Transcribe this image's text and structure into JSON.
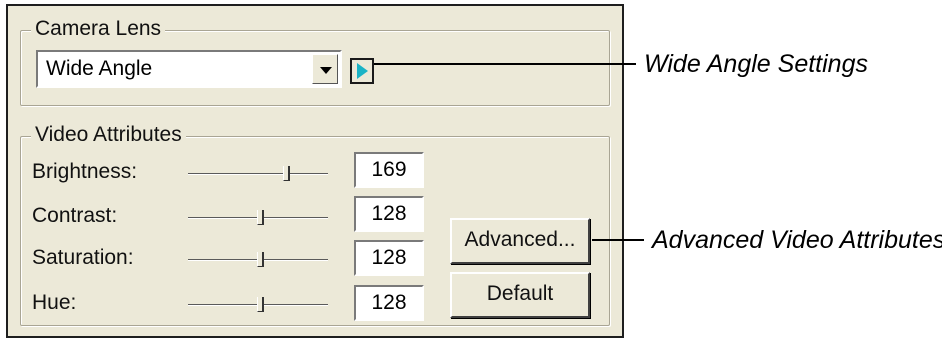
{
  "camera_lens": {
    "group_title": "Camera Lens",
    "selected_value": "Wide Angle"
  },
  "video_attributes": {
    "group_title": "Video Attributes",
    "rows": [
      {
        "label": "Brightness:",
        "value": "169"
      },
      {
        "label": "Contrast:",
        "value": "128"
      },
      {
        "label": "Saturation:",
        "value": "128"
      },
      {
        "label": "Hue:",
        "value": "128"
      }
    ],
    "advanced_button": "Advanced...",
    "default_button": "Default"
  },
  "callouts": {
    "wide_angle": "Wide Angle Settings",
    "advanced": "Advanced Video Attributes"
  },
  "colors": {
    "panel_bg": "#ece9d8",
    "play_icon": "#1ab3c6"
  }
}
